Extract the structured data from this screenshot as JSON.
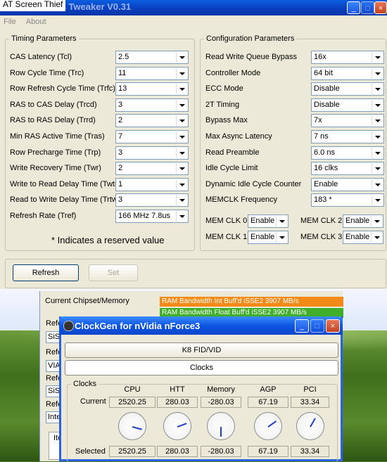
{
  "main_window": {
    "title_overlay": "AT Screen Thief",
    "title": "A64 Tweaker V0.31",
    "menu": [
      "File",
      "About"
    ],
    "timing_group": "Timing Parameters",
    "timing": [
      {
        "label": "CAS Latency (Tcl)",
        "value": "2.5"
      },
      {
        "label": "Row Cycle Time (Trc)",
        "value": "11"
      },
      {
        "label": "Row Refresh Cycle Time (Trfc)",
        "value": "13"
      },
      {
        "label": "RAS to CAS Delay (Trcd)",
        "value": "3"
      },
      {
        "label": "RAS to RAS Delay (Trrd)",
        "value": "2"
      },
      {
        "label": "Min RAS Active Time (Tras)",
        "value": "7"
      },
      {
        "label": "Row Precharge Time (Trp)",
        "value": "3"
      },
      {
        "label": "Write Recovery Time (Twr)",
        "value": "2"
      },
      {
        "label": "Write to Read Delay Time (Twtr)",
        "value": "1"
      },
      {
        "label": "Read to Write Delay Time (Trtw)",
        "value": "3"
      },
      {
        "label": "Refresh Rate (Tref)",
        "value": "166 MHz 7.8us"
      }
    ],
    "reserved_note": "* Indicates a reserved value",
    "config_group": "Configuration Parameters",
    "config": [
      {
        "label": "Read Write Queue Bypass",
        "value": "16x"
      },
      {
        "label": "Controller Mode",
        "value": "64 bit"
      },
      {
        "label": "ECC Mode",
        "value": "Disable"
      },
      {
        "label": "2T Timing",
        "value": "Disable"
      },
      {
        "label": "Bypass Max",
        "value": "7x"
      },
      {
        "label": "Max Async Latency",
        "value": "7 ns"
      },
      {
        "label": "Read Preamble",
        "value": "6.0 ns"
      },
      {
        "label": "Idle Cycle Limit",
        "value": "16 clks"
      },
      {
        "label": "Dynamic Idle Cycle Counter",
        "value": "Enable"
      },
      {
        "label": "MEMCLK Frequency",
        "value": "183 *"
      }
    ],
    "memclk": [
      {
        "label": "MEM CLK 0",
        "value": "Enable"
      },
      {
        "label": "MEM CLK 2",
        "value": "Enable"
      },
      {
        "label": "MEM CLK 1",
        "value": "Enable"
      },
      {
        "label": "MEM CLK 3",
        "value": "Enable"
      }
    ],
    "refresh_label": "Refresh",
    "set_label": "Set"
  },
  "back_window": {
    "chipset_label": "Current Chipset/Memory",
    "bar_int": "RAM Bandwidth Int Buff'd iSSE2 3907 MB/s",
    "bar_float": "RAM Bandwidth Float Buff'd iSSE2 3907 MB/s",
    "ref_labels": [
      "Refe",
      "Refe",
      "Refe",
      "Refe",
      "Refe"
    ],
    "ref_values": [
      "SiS",
      "VIA",
      "SiS",
      "Inte"
    ],
    "item_label": "Ite",
    "bar_int_color": "#f38a17",
    "bar_float_color": "#3fae2a"
  },
  "clockgen": {
    "title": "ClockGen for nVidia nForce3",
    "tab_k8": "K8 FID/VID",
    "tab_clocks": "Clocks",
    "group": "Clocks",
    "columns": [
      "CPU",
      "HTT",
      "Memory",
      "AGP",
      "PCI"
    ],
    "current_label": "Current",
    "selected_label": "Selected",
    "current": [
      "2520.25",
      "280.03",
      "-280.03",
      "67.19",
      "33.34"
    ],
    "selected": [
      "2520.25",
      "280.03",
      "-280.03",
      "67.19",
      "33.34"
    ]
  }
}
